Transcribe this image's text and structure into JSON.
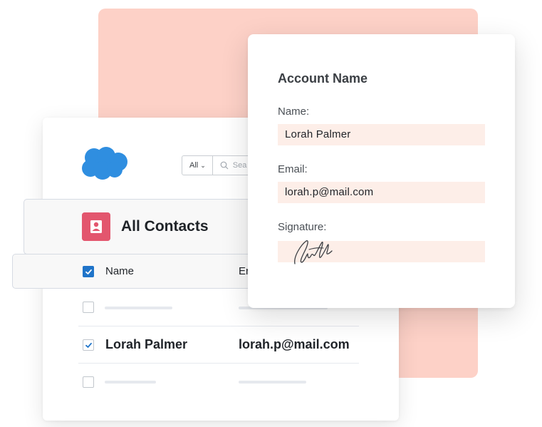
{
  "search": {
    "filter_label": "All",
    "placeholder": "Sea"
  },
  "contacts": {
    "title": "All Contacts",
    "columns": {
      "name": "Name",
      "email": "Er"
    },
    "rows": [
      {
        "name": "",
        "email": "",
        "checked": false
      },
      {
        "name": "Lorah Palmer",
        "email": "lorah.p@mail.com",
        "checked": true
      },
      {
        "name": "",
        "email": "",
        "checked": false
      }
    ]
  },
  "account": {
    "title": "Account Name",
    "name_label": "Name:",
    "name_value": "Lorah Palmer",
    "email_label": "Email:",
    "email_value": "lorah.p@mail.com",
    "signature_label": "Signature:"
  },
  "colors": {
    "accent_blue": "#1f74c9",
    "cloud_blue": "#2f8ee0",
    "contact_icon": "#e3566e",
    "pink_background": "#fdd1c7",
    "field_background": "#fdeee8"
  }
}
